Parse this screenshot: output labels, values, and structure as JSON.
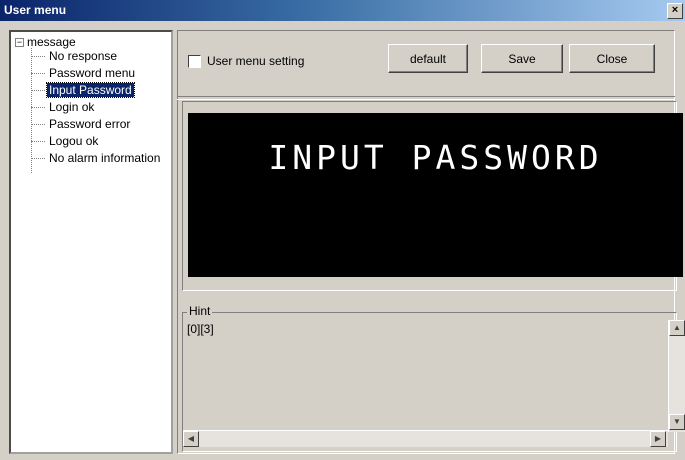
{
  "window": {
    "title": "User menu",
    "close_glyph": "×"
  },
  "tree": {
    "root_label": "message",
    "expander_glyph": "−",
    "items": [
      {
        "label": "No response"
      },
      {
        "label": "Password menu"
      },
      {
        "label": "Input Password",
        "selected": true
      },
      {
        "label": "Login ok"
      },
      {
        "label": "Password error"
      },
      {
        "label": "Logou ok"
      },
      {
        "label": "No alarm information"
      }
    ]
  },
  "toolbar": {
    "checkbox_label": "User menu setting",
    "checkbox_checked": false,
    "default_label": "default",
    "save_label": "Save",
    "close_label": "Close"
  },
  "display": {
    "text": "INPUT PASSWORD"
  },
  "hint": {
    "legend": "Hint",
    "text": "[0][3]"
  },
  "scroll": {
    "up": "▲",
    "down": "▼",
    "left": "◀",
    "right": "▶"
  },
  "colors": {
    "title_start": "#0a246a",
    "title_end": "#a6caf0",
    "selection": "#0a246a",
    "display_bg": "#000000"
  }
}
